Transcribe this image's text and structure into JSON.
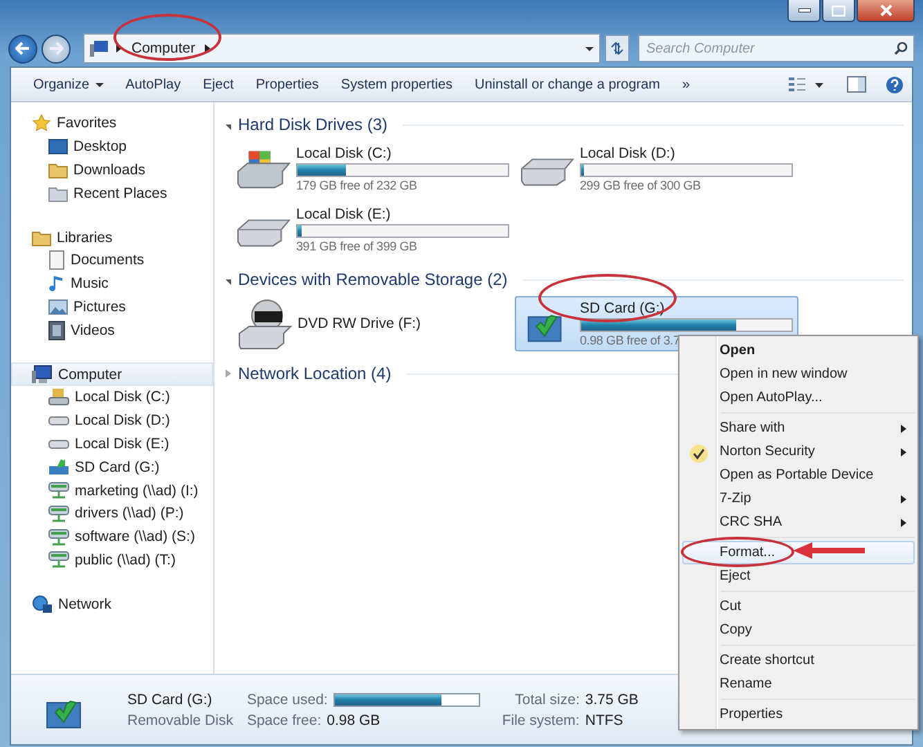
{
  "address": {
    "breadcrumb": [
      {
        "label": "Computer"
      }
    ],
    "search": {
      "placeholder": "Search Computer"
    }
  },
  "toolbar": {
    "items": [
      {
        "label": "Organize",
        "dropdown": true
      },
      {
        "label": "AutoPlay",
        "dropdown": false
      },
      {
        "label": "Eject",
        "dropdown": false
      },
      {
        "label": "Properties",
        "dropdown": false
      },
      {
        "label": "System properties",
        "dropdown": false
      },
      {
        "label": "Uninstall or change a program",
        "dropdown": false
      }
    ],
    "overflow": "»"
  },
  "nav": [
    {
      "label": "Favorites",
      "kind": "favorites",
      "selected": false,
      "children": [
        {
          "label": "Desktop",
          "kind": "desktop",
          "selected": false
        },
        {
          "label": "Downloads",
          "kind": "folder",
          "selected": false
        },
        {
          "label": "Recent Places",
          "kind": "recent",
          "selected": false
        }
      ]
    },
    {
      "label": "Libraries",
      "kind": "library",
      "selected": false,
      "children": [
        {
          "label": "Documents",
          "kind": "document",
          "selected": false
        },
        {
          "label": "Music",
          "kind": "music",
          "selected": false
        },
        {
          "label": "Pictures",
          "kind": "pictures",
          "selected": false
        },
        {
          "label": "Videos",
          "kind": "video",
          "selected": false
        }
      ]
    },
    {
      "label": "Computer",
      "kind": "computer",
      "selected": true,
      "children": [
        {
          "label": "Local Disk (C:)",
          "kind": "system-disk",
          "selected": false
        },
        {
          "label": "Local Disk (D:)",
          "kind": "disk",
          "selected": false
        },
        {
          "label": "Local Disk (E:)",
          "kind": "disk",
          "selected": false
        },
        {
          "label": "SD Card (G:)",
          "kind": "sd",
          "selected": false
        },
        {
          "label": "marketing (\\\\ad) (I:)",
          "kind": "network-drive",
          "selected": false
        },
        {
          "label": "drivers (\\\\ad) (P:)",
          "kind": "network-drive",
          "selected": false
        },
        {
          "label": "software (\\\\ad) (S:)",
          "kind": "network-drive",
          "selected": false
        },
        {
          "label": "public (\\\\ad) (T:)",
          "kind": "network-drive",
          "selected": false
        }
      ]
    },
    {
      "label": "Network",
      "kind": "network",
      "selected": false
    }
  ],
  "sections": [
    {
      "title": "Hard Disk Drives (3)",
      "expanded": true,
      "items": [
        {
          "name": "Local Disk (C:)",
          "kind": "system-disk",
          "level": 0.23,
          "reading": "179 GB free of 232 GB",
          "selected": false
        },
        {
          "name": "Local Disk (D:)",
          "kind": "disk",
          "level": 0.01,
          "reading": "299 GB free of 300 GB",
          "selected": false
        },
        {
          "name": "Local Disk (E:)",
          "kind": "disk",
          "level": 0.02,
          "reading": "391 GB free of 399 GB",
          "selected": false
        }
      ]
    },
    {
      "title": "Devices with Removable Storage (2)",
      "expanded": true,
      "items": [
        {
          "name": "DVD RW Drive (F:)",
          "kind": "dvd",
          "selected": false
        },
        {
          "name": "SD Card (G:)",
          "kind": "sd",
          "level": 0.74,
          "reading": "0.98 GB free of 3.7",
          "selected": true
        }
      ]
    },
    {
      "title": "Network Location (4)",
      "expanded": false
    }
  ],
  "context_menu": [
    {
      "kind": "item",
      "label": "Open",
      "default": true,
      "submenu": false,
      "checked": false,
      "selected": false
    },
    {
      "kind": "item",
      "label": "Open in new window",
      "default": false,
      "submenu": false,
      "checked": false,
      "selected": false
    },
    {
      "kind": "item",
      "label": "Open AutoPlay...",
      "default": false,
      "submenu": false,
      "checked": false,
      "selected": false
    },
    {
      "kind": "separator"
    },
    {
      "kind": "item",
      "label": "Share with",
      "default": false,
      "submenu": true,
      "checked": false,
      "selected": false
    },
    {
      "kind": "item",
      "label": "Norton Security",
      "default": false,
      "submenu": true,
      "checked": true,
      "selected": false
    },
    {
      "kind": "item",
      "label": "Open as Portable Device",
      "default": false,
      "submenu": false,
      "checked": false,
      "selected": false
    },
    {
      "kind": "item",
      "label": "7-Zip",
      "default": false,
      "submenu": true,
      "checked": false,
      "selected": false
    },
    {
      "kind": "item",
      "label": "CRC SHA",
      "default": false,
      "submenu": true,
      "checked": false,
      "selected": false
    },
    {
      "kind": "separator"
    },
    {
      "kind": "item",
      "label": "Format...",
      "default": false,
      "submenu": false,
      "checked": false,
      "selected": true
    },
    {
      "kind": "item",
      "label": "Eject",
      "default": false,
      "submenu": false,
      "checked": false,
      "selected": false
    },
    {
      "kind": "separator"
    },
    {
      "kind": "item",
      "label": "Cut",
      "default": false,
      "submenu": false,
      "checked": false,
      "selected": false
    },
    {
      "kind": "item",
      "label": "Copy",
      "default": false,
      "submenu": false,
      "checked": false,
      "selected": false
    },
    {
      "kind": "separator"
    },
    {
      "kind": "item",
      "label": "Create shortcut",
      "default": false,
      "submenu": false,
      "checked": false,
      "selected": false
    },
    {
      "kind": "item",
      "label": "Rename",
      "default": false,
      "submenu": false,
      "checked": false,
      "selected": false
    },
    {
      "kind": "separator"
    },
    {
      "kind": "item",
      "label": "Properties",
      "default": false,
      "submenu": false,
      "checked": false,
      "selected": false
    }
  ],
  "details": {
    "name": "SD Card (G:)",
    "type": "Removable Disk",
    "used_label": "Space used:",
    "level": 0.74,
    "free_label": "Space free:",
    "free_value": "0.98 GB",
    "total_label": "Total size:",
    "total_value": "3.75 GB",
    "fs_label": "File system:",
    "fs_value": "NTFS"
  }
}
